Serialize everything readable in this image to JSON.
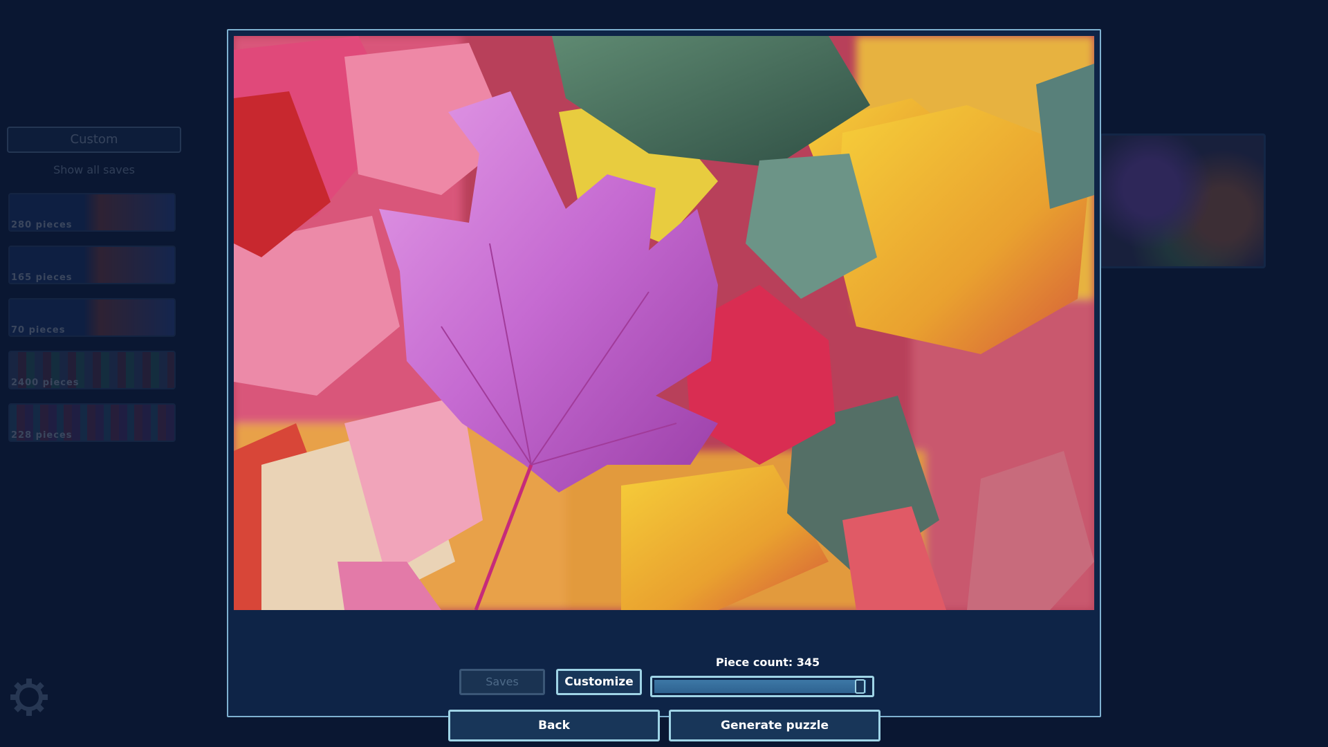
{
  "background_menu": {
    "custom_label": "Custom",
    "show_saves_label": "Show all saves",
    "saves": [
      {
        "pieces": "280 pieces"
      },
      {
        "pieces": "165 pieces"
      },
      {
        "pieces": "70 pieces"
      },
      {
        "pieces": "2400 pieces"
      },
      {
        "pieces": "228 pieces"
      }
    ],
    "settings_icon": "gear-icon"
  },
  "dialog": {
    "piece_count_label": "Piece count: 345",
    "piece_count": 345,
    "slider_fill_fraction": 0.98,
    "saves_label": "Saves",
    "customize_label": "Customize",
    "back_label": "Back",
    "generate_label": "Generate puzzle"
  },
  "colors": {
    "background": "#0a1732",
    "panel": "#0e2447",
    "button_border": "#9fd4e6",
    "button_fill": "#183659",
    "slider_fill": "#3d78a6"
  }
}
